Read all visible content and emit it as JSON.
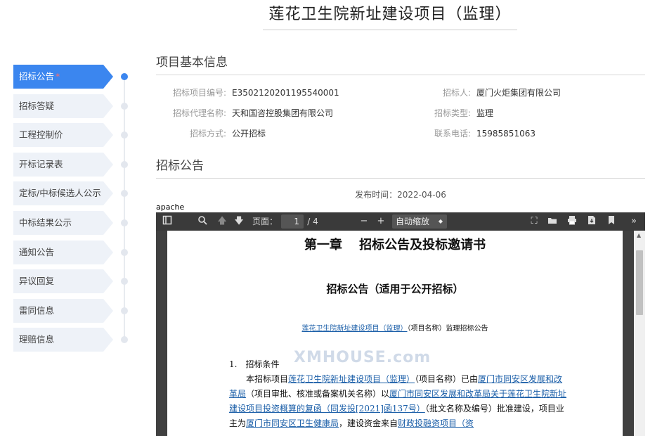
{
  "page": {
    "title": "莲花卫生院新址建设项目（监理）"
  },
  "sidebar": {
    "items": [
      {
        "label": "招标公告",
        "active": true,
        "marker": "*"
      },
      {
        "label": "招标答疑"
      },
      {
        "label": "工程控制价"
      },
      {
        "label": "开标记录表"
      },
      {
        "label": "定标/中标候选人公示"
      },
      {
        "label": "中标结果公示"
      },
      {
        "label": "通知公告"
      },
      {
        "label": "异议回复"
      },
      {
        "label": "雷同信息"
      },
      {
        "label": "理赔信息"
      }
    ]
  },
  "basic_info": {
    "title": "项目基本信息",
    "fields": [
      {
        "label": "招标项目编号:",
        "value": "E3502120201195540001"
      },
      {
        "label": "招标人:",
        "value": "厦门火炬集团有限公司"
      },
      {
        "label": "招标代理名称:",
        "value": "天和国咨控股集团有限公司"
      },
      {
        "label": "招标类型:",
        "value": "监理"
      },
      {
        "label": "招标方式:",
        "value": "公开招标"
      },
      {
        "label": "联系电话:",
        "value": "15985851063"
      }
    ]
  },
  "notice": {
    "title": "招标公告",
    "publish_label": "发布时间：",
    "publish_date": "2022-04-06"
  },
  "viewer": {
    "frame_text": "apache",
    "page_label": "页面：",
    "page_current": "1",
    "page_total": "/ 4",
    "zoom_value": "自动缩放",
    "icons": [
      "sidebar-toggle-icon",
      "search-icon",
      "prev-page-icon",
      "next-page-icon",
      "zoom-out-icon",
      "zoom-in-icon",
      "presentation-icon",
      "open-file-icon",
      "print-icon",
      "download-icon",
      "bookmark-icon",
      "more-tools-icon"
    ]
  },
  "document": {
    "chapter": "第一章　 招标公告及投标邀请书",
    "subtitle": "招标公告（适用于公开招标）",
    "project_link": "莲花卫生院新址建设项目（监理）",
    "project_suffix": "（项目名称）监理招标公告",
    "section1": "1.　招标条件",
    "p1_a": "本招标项目",
    "p1_link1": "莲花卫生院新址建设项目（监理）",
    "p1_b": "（项目名称）已由",
    "p1_link2": "厦门市同安区发展和改革局",
    "p1_c": "（项目审批、核准或备案机关名称）以",
    "p1_link3": "厦门市同安区发展和改革局关于莲花卫生院新址建设项目投资概算的复函（同发投[2021]函137号）",
    "p1_d": "（批文名称及编号）批准建设，项目业主为",
    "p1_link4": "厦门市同安区卫生健康局",
    "p1_e": "，建设资金来自",
    "p1_link5": "财政投融资项目（资",
    "watermark": "XMHOUSE.com"
  }
}
